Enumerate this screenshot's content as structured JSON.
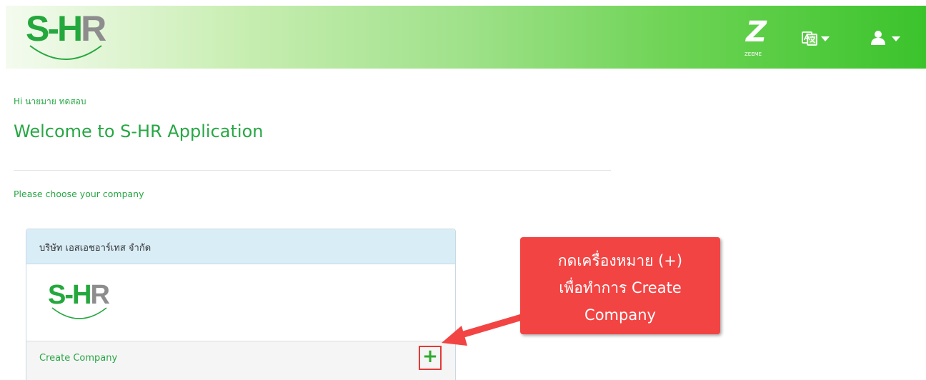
{
  "header": {
    "logo": {
      "left": "S-H",
      "right": "R"
    },
    "zeeme_icon": {
      "letter": "Z",
      "label": "ZEEME"
    },
    "language_icon": "translate-icon",
    "user_icon": "user-icon"
  },
  "greeting": "Hi นายมาย ทดสอบ",
  "welcome_title": "Welcome to S-HR Application",
  "choose_label": "Please choose your company",
  "company_card": {
    "company_name": "บริษัท เอสเอชอาร์เทส จำกัด",
    "logo": {
      "left": "S-H",
      "right": "R"
    },
    "create_label": "Create Company",
    "add_icon": "+"
  },
  "annotation": {
    "lines": [
      "กดเครื่องหมาย (+)",
      "เพื่อทำการ Create",
      "Company"
    ]
  },
  "colors": {
    "brand_green": "#28a745",
    "header_gradient_start": "#f4fbef",
    "header_gradient_end": "#3bc32c",
    "card_header": "#d9edf7",
    "callout_red": "#f34444",
    "highlight_red": "#e53935"
  }
}
